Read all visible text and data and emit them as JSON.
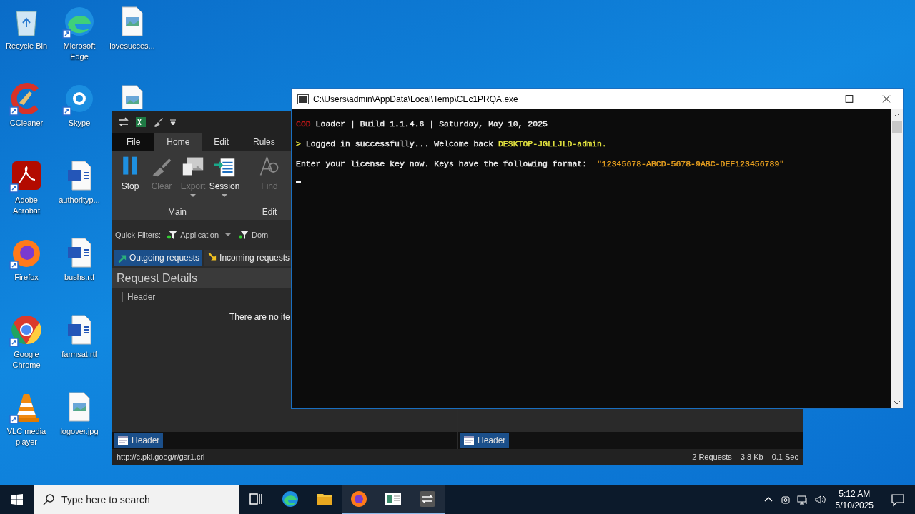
{
  "desktop_icons": [
    {
      "kind": "recycle",
      "label": "Recycle Bin",
      "shortcut": false
    },
    {
      "kind": "ccleaner",
      "label": "CCleaner",
      "shortcut": true
    },
    {
      "kind": "acrobat",
      "label": "Adobe Acrobat",
      "shortcut": true
    },
    {
      "kind": "firefox",
      "label": "Firefox",
      "shortcut": true
    },
    {
      "kind": "chrome",
      "label": "Google Chrome",
      "shortcut": true
    },
    {
      "kind": "vlc",
      "label": "VLC media player",
      "shortcut": true
    },
    {
      "kind": "edge",
      "label": "Microsoft Edge",
      "shortcut": true
    },
    {
      "kind": "skype",
      "label": "Skype",
      "shortcut": true
    },
    {
      "kind": "word",
      "label": "authorityp...",
      "shortcut": false
    },
    {
      "kind": "word",
      "label": "bushs.rtf",
      "shortcut": false
    },
    {
      "kind": "word",
      "label": "farmsat.rtf",
      "shortcut": false
    },
    {
      "kind": "image",
      "label": "logover.jpg",
      "shortcut": false
    },
    {
      "kind": "image",
      "label": "lovesucces...",
      "shortcut": false
    },
    {
      "kind": "image",
      "shortcut": false,
      "covered": true
    }
  ],
  "fiddler": {
    "menu_tabs": [
      {
        "label": "File",
        "selected": false
      },
      {
        "label": "Home",
        "selected": true
      },
      {
        "label": "Edit",
        "selected": false
      },
      {
        "label": "Rules",
        "selected": false
      }
    ],
    "ribbon_buttons": [
      {
        "kind": "stop",
        "label": "Stop",
        "disabled": false,
        "dropdown": false
      },
      {
        "kind": "clear",
        "label": "Clear",
        "disabled": true,
        "dropdown": false
      },
      {
        "kind": "export",
        "label": "Export",
        "disabled": true,
        "dropdown": true
      },
      {
        "kind": "session",
        "label": "Session",
        "disabled": false,
        "dropdown": true
      }
    ],
    "ribbon_group_main": "Main",
    "edit_buttons": [
      {
        "kind": "find",
        "label": "Find",
        "disabled": true
      }
    ],
    "ribbon_group_edit": "Edit",
    "quick_filters": {
      "label": "Quick Filters:",
      "filters": [
        "Application",
        "Dom"
      ]
    },
    "traffic_tabs": [
      {
        "label": "Outgoing requests",
        "selected": true
      },
      {
        "label": "Incoming requests",
        "selected": false
      }
    ],
    "request_details": {
      "title": "Request Details",
      "column": "Header",
      "empty": "There are no ite"
    },
    "bottom_tabs": [
      "Header",
      "Header"
    ],
    "status_bar": {
      "url": "http://c.pki.goog/r/gsr1.crl",
      "requests": "2 Requests",
      "size": "3.8 Kb",
      "time": "0.1 Sec"
    }
  },
  "console": {
    "title": "C:\\Users\\admin\\AppData\\Local\\Temp\\CEc1PRQA.exe",
    "lines": [
      [
        {
          "text": "COD",
          "color": "#c01818"
        },
        {
          "text": " Loader | Build 1.1.4.6 | Saturday, May 10, 2025",
          "color": "#f2f2f2"
        }
      ],
      [
        {
          "text": ">",
          "color": "#e8e840"
        },
        {
          "text": " Logged in successfully... Welcome back ",
          "color": "#f2f2f2"
        },
        {
          "text": "DESKTOP-JGLLJLD-admin.",
          "color": "#e8e840"
        }
      ],
      [
        {
          "text": "Enter your license key now. Keys have the following format:  ",
          "color": "#f2f2f2"
        },
        {
          "text": "\"12345678-ABCD-5678-9ABC-DEF123456789\"",
          "color": "#e8a020"
        }
      ]
    ]
  },
  "taskbar": {
    "search_placeholder": "Type here to search",
    "apps": [
      {
        "kind": "taskview",
        "active": false
      },
      {
        "kind": "edge",
        "active": false
      },
      {
        "kind": "explorer",
        "active": false
      },
      {
        "kind": "firefox",
        "active": true
      },
      {
        "kind": "window",
        "active": true
      },
      {
        "kind": "fiddler",
        "active": true
      }
    ],
    "time": "5:12 AM",
    "date": "5/10/2025"
  }
}
